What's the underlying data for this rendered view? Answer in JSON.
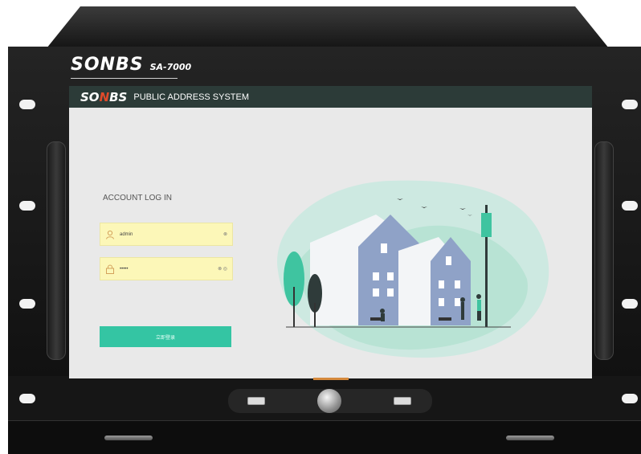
{
  "device": {
    "brand": "SONBS",
    "model": "SA-7000"
  },
  "screen": {
    "header_logo": "SONBS",
    "header_title": "PUBLIC ADDRESS SYSTEM",
    "login": {
      "title": "ACCOUNT LOG IN",
      "username_value": "admin",
      "username_suffix": "⊗",
      "password_value": "•••••",
      "password_suffix": "⊗ ◎",
      "button_label": "立即登录"
    }
  },
  "colors": {
    "header_bg": "#2c3b38",
    "accent": "#34c5a3",
    "field_bg": "#fcf7b8"
  },
  "icons": [
    "user-icon",
    "lock-icon",
    "clear-icon",
    "eye-icon"
  ]
}
